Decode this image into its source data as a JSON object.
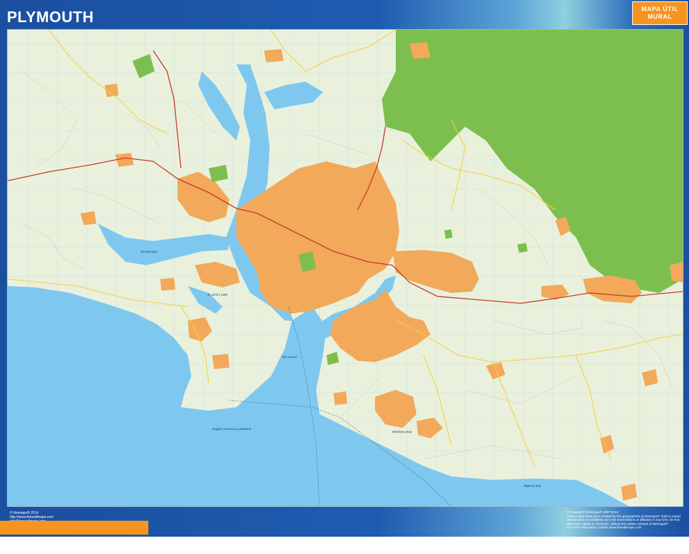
{
  "header": {
    "title": "PLYMOUTH",
    "badge_line1": "MAPA ÚTIL",
    "badge_line2": "MURAL"
  },
  "map": {
    "place_labels": [
      "St Germans",
      "St John's Lake",
      "The Sound",
      "English Channel La Manche",
      "Wembury Bay",
      "Bigbury Bay"
    ],
    "colors": {
      "sea": "#7ec8ef",
      "land": "#e9f1dc",
      "urban": "#f2a95a",
      "park": "#7dbf4e",
      "road_major": "#c0392b",
      "road_secondary": "#f4d03f",
      "frame": "#1b4fa0",
      "accent": "#f7941d"
    }
  },
  "footer": {
    "left_line1": "© Netmaps® 2014",
    "left_line2": "http://www.thewallmaps.com",
    "left_line3": "info@thewallmaps.com",
    "right_line1": "© Copyright ©Netmaps® 1997-2014",
    "right_line2": "These maps have been created by the geographers at Netmaps® Total or partial",
    "right_line3": "reproduction is prohibited, as is the transmission or diffusion in any form, be that",
    "right_line4": "electronic, digital or mechanic, without the written consent of Netmaps®",
    "right_line5": "For more information consult: www.thewallmaps.com"
  }
}
